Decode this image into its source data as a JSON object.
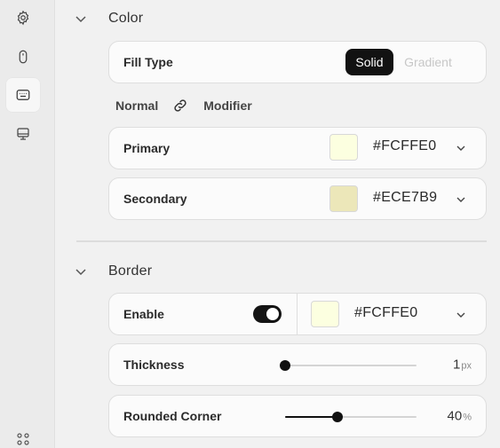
{
  "rail": {
    "items": [
      {
        "icon": "gear-icon"
      },
      {
        "icon": "mouse-icon"
      },
      {
        "icon": "keyboard-icon",
        "active": true
      },
      {
        "icon": "monitor-icon"
      }
    ],
    "bottom_icon": "grid-dots-icon"
  },
  "color": {
    "title": "Color",
    "fill_type_label": "Fill Type",
    "fill_options": [
      "Solid",
      "Gradient"
    ],
    "fill_selected": "Solid",
    "mode_normal": "Normal",
    "mode_modifier": "Modifier",
    "primary": {
      "label": "Primary",
      "hex": "#FCFFE0",
      "swatch": "#FCFFE0"
    },
    "secondary": {
      "label": "Secondary",
      "hex": "#ECE7B9",
      "swatch": "#ECE7B9"
    }
  },
  "border": {
    "title": "Border",
    "enable_label": "Enable",
    "enabled": true,
    "color": {
      "hex": "#FCFFE0",
      "swatch": "#FCFFE0"
    },
    "thickness": {
      "label": "Thickness",
      "value": "1",
      "unit": "px",
      "fraction": 0.0
    },
    "rounded": {
      "label": "Rounded Corner",
      "value": "40",
      "unit": "%",
      "fraction": 0.4
    }
  }
}
